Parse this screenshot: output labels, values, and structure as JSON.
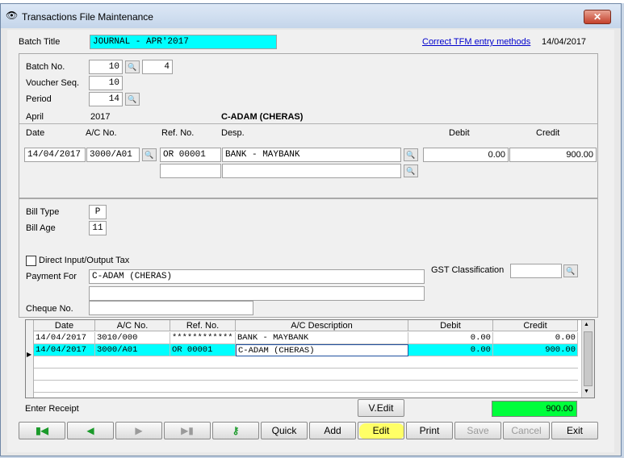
{
  "window": {
    "title": "Transactions File Maintenance",
    "close_label": "✕"
  },
  "header": {
    "batch_title_label": "Batch Title",
    "batch_title_value": "JOURNAL - APR'2017",
    "help_link": "Correct TFM entry methods",
    "date": "14/04/2017"
  },
  "batch": {
    "batch_no_label": "Batch No.",
    "batch_no_value": "10",
    "batch_no_sub": "4",
    "voucher_label": "Voucher Seq.",
    "voucher_value": "10",
    "period_label": "Period",
    "period_value": "14",
    "month": "April",
    "year": "2017",
    "account_name": "C-ADAM (CHERAS)"
  },
  "entry": {
    "headers": {
      "date": "Date",
      "ac_no": "A/C No.",
      "ref_no": "Ref. No.",
      "desp": "Desp.",
      "debit": "Debit",
      "credit": "Credit"
    },
    "date": "14/04/2017",
    "ac_no": "3000/A01",
    "ref_no": "OR 00001",
    "desp": "BANK - MAYBANK",
    "debit": "0.00",
    "credit": "900.00"
  },
  "bill": {
    "type_label": "Bill Type",
    "type_value": "P",
    "age_label": "Bill Age",
    "age_value": "11"
  },
  "tax": {
    "direct_label": "Direct Input/Output Tax",
    "payment_label": "Payment For",
    "payment_value": "C-ADAM (CHERAS)",
    "gst_label": "GST Classification",
    "cheque_label": "Cheque No."
  },
  "grid": {
    "headers": [
      "Date",
      "A/C No.",
      "Ref. No.",
      "A/C Description",
      "Debit",
      "Credit"
    ],
    "rows": [
      [
        "14/04/2017",
        "3010/000",
        "************",
        "BANK - MAYBANK",
        "0.00",
        "0.00"
      ],
      [
        "14/04/2017",
        "3000/A01",
        "OR 00001",
        "C-ADAM (CHERAS)",
        "0.00",
        "900.00"
      ]
    ],
    "selected_row": 1
  },
  "footer": {
    "status": "Enter Receipt",
    "vedit_label": "V.Edit",
    "total": "900.00"
  },
  "toolbar": {
    "first_icon": "first-record-icon",
    "prev_icon": "previous-record-icon",
    "next_icon": "next-record-icon",
    "last_icon": "last-record-icon",
    "search_icon": "key-search-icon",
    "quick": "Quick",
    "add": "Add",
    "edit": "Edit",
    "print": "Print",
    "save": "Save",
    "cancel": "Cancel",
    "exit": "Exit"
  },
  "colors": {
    "highlight": "#00ffff",
    "total_bg": "#00ff3b",
    "edit_highlight": "#ffff66",
    "nav_green": "#1a9a2a"
  }
}
